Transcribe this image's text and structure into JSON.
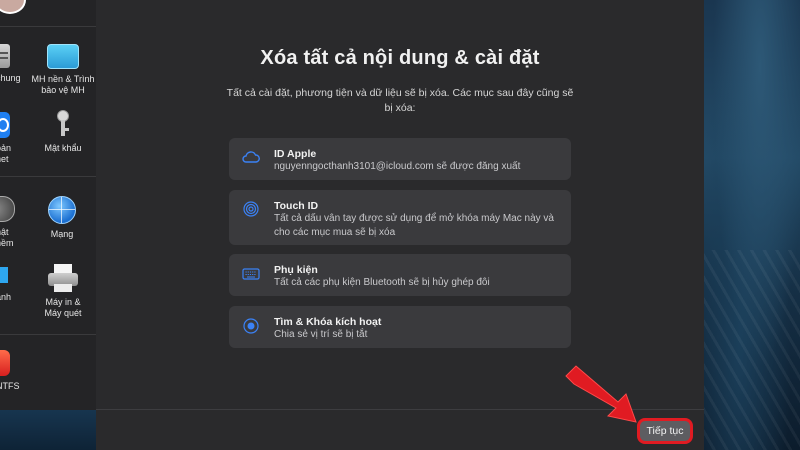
{
  "sidebar": {
    "items": [
      {
        "label": "chung",
        "icon": "general-icon"
      },
      {
        "label": "MH nền & Trình bảo vệ MH",
        "icon": "desktop-screensaver-icon"
      },
      {
        "label": "oản\nhet",
        "icon": "internet-accounts-icon"
      },
      {
        "label": "Mật khẩu",
        "icon": "key-icon"
      },
      {
        "label": "hật\nnềm",
        "icon": "software-update-icon"
      },
      {
        "label": "Mạng",
        "icon": "network-globe-icon"
      },
      {
        "label": "ành",
        "icon": "display-icon"
      },
      {
        "label": "Máy in & Máy quét",
        "icon": "printer-icon"
      },
      {
        "label": "NTFS",
        "icon": "ntfs-icon"
      }
    ]
  },
  "dialog": {
    "title": "Xóa tất cả nội dung & cài đặt",
    "subtitle": "Tất cả cài đặt, phương tiện và dữ liệu sẽ bị xóa. Các mục sau đây cũng sẽ bị xóa:",
    "cards": [
      {
        "title": "ID Apple",
        "desc": "nguyenngocthanh3101@icloud.com sẽ được đăng xuất",
        "icon": "cloud-icon"
      },
      {
        "title": "Touch ID",
        "desc": "Tất cả dấu vân tay được sử dụng để mở khóa máy Mac này và cho các mục mua sẽ bị xóa",
        "icon": "fingerprint-icon"
      },
      {
        "title": "Phụ kiện",
        "desc": "Tất cả các phụ kiện Bluetooth sẽ bị hủy ghép đôi",
        "icon": "keyboard-icon"
      },
      {
        "title": "Tìm & Khóa kích hoạt",
        "desc": "Chia sẻ vị trí sẽ bị tắt",
        "icon": "find-my-icon"
      }
    ],
    "continue_label": "Tiếp tục"
  },
  "colors": {
    "dialog_bg": "#2a2a2c",
    "card_bg": "#3a3a3d",
    "icon_blue": "#3b82f6",
    "highlight_red": "#e01b22"
  }
}
